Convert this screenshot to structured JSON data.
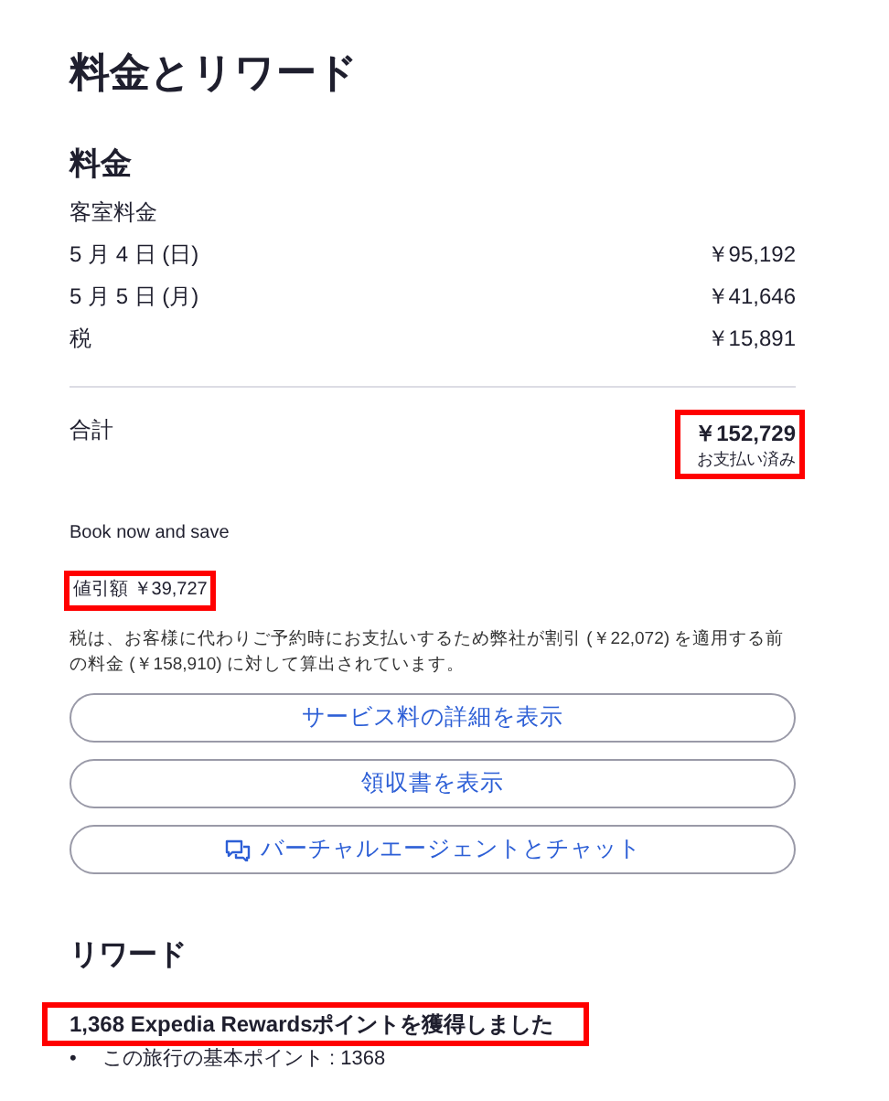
{
  "title": "料金とリワード",
  "charges": {
    "heading": "料金",
    "subheading": "客室料金",
    "rows": [
      {
        "label": "5 月 4 日 (日)",
        "amount": "￥95,192"
      },
      {
        "label": "5 月 5 日 (月)",
        "amount": "￥41,646"
      },
      {
        "label": "税",
        "amount": "￥15,891"
      }
    ],
    "total": {
      "label": "合計",
      "amount": "￥152,729",
      "note": "お支払い済み",
      "highlighted": true
    },
    "promo": "Book now and save",
    "discount": {
      "text": "値引額 ￥39,727",
      "highlighted": true
    },
    "tax_note": "税は、お客様に代わりご予約時にお支払いするため弊社が割引 (￥22,072) を適用する前の料金 (￥158,910) に対して算出されています。",
    "buttons": [
      {
        "label": "サービス料の詳細を表示",
        "kind": "plain"
      },
      {
        "label": "領収書を表示",
        "kind": "plain"
      },
      {
        "label": "バーチャルエージェントとチャット",
        "kind": "chat"
      }
    ]
  },
  "rewards": {
    "heading": "リワード",
    "earned": {
      "text": "1,368 Expedia Rewardsポイントを獲得しました",
      "highlighted": true
    },
    "items": [
      {
        "bullet": "•",
        "text": "この旅行の基本ポイント : 1368"
      }
    ]
  }
}
